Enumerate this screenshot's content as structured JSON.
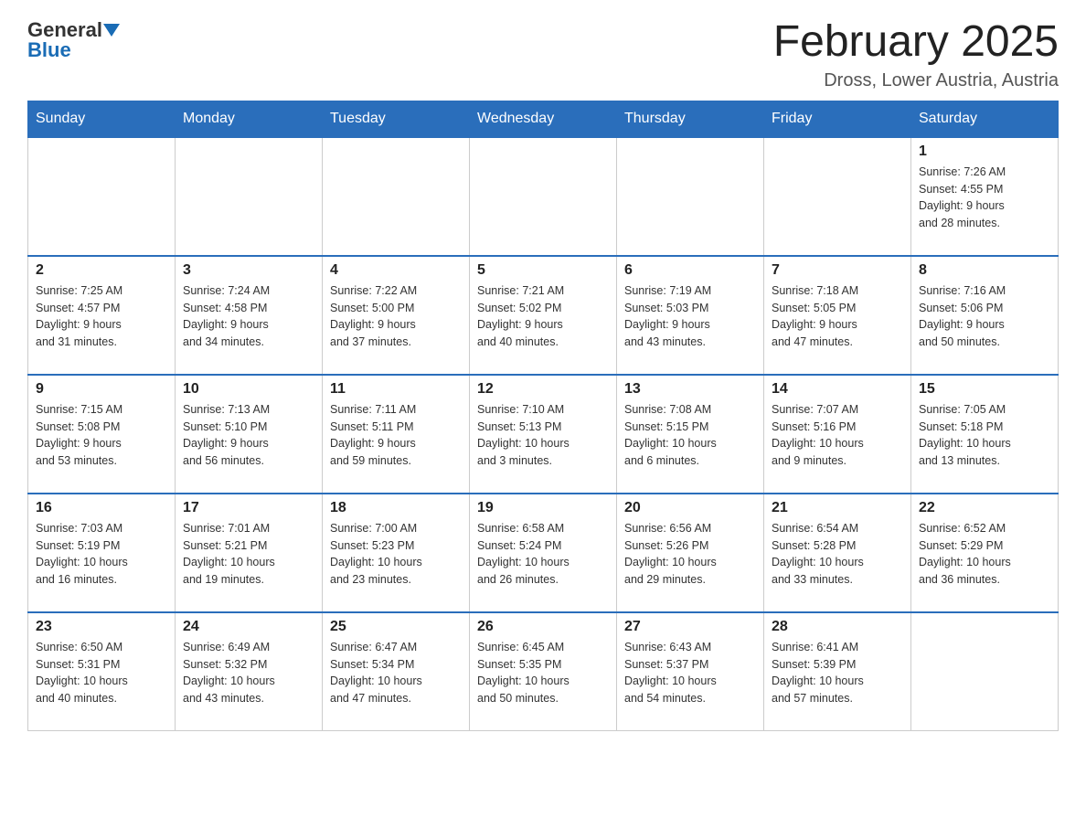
{
  "header": {
    "logo_general": "General",
    "logo_blue": "Blue",
    "month_title": "February 2025",
    "location": "Dross, Lower Austria, Austria"
  },
  "weekdays": [
    "Sunday",
    "Monday",
    "Tuesday",
    "Wednesday",
    "Thursday",
    "Friday",
    "Saturday"
  ],
  "weeks": [
    [
      {
        "day": "",
        "info": ""
      },
      {
        "day": "",
        "info": ""
      },
      {
        "day": "",
        "info": ""
      },
      {
        "day": "",
        "info": ""
      },
      {
        "day": "",
        "info": ""
      },
      {
        "day": "",
        "info": ""
      },
      {
        "day": "1",
        "info": "Sunrise: 7:26 AM\nSunset: 4:55 PM\nDaylight: 9 hours\nand 28 minutes."
      }
    ],
    [
      {
        "day": "2",
        "info": "Sunrise: 7:25 AM\nSunset: 4:57 PM\nDaylight: 9 hours\nand 31 minutes."
      },
      {
        "day": "3",
        "info": "Sunrise: 7:24 AM\nSunset: 4:58 PM\nDaylight: 9 hours\nand 34 minutes."
      },
      {
        "day": "4",
        "info": "Sunrise: 7:22 AM\nSunset: 5:00 PM\nDaylight: 9 hours\nand 37 minutes."
      },
      {
        "day": "5",
        "info": "Sunrise: 7:21 AM\nSunset: 5:02 PM\nDaylight: 9 hours\nand 40 minutes."
      },
      {
        "day": "6",
        "info": "Sunrise: 7:19 AM\nSunset: 5:03 PM\nDaylight: 9 hours\nand 43 minutes."
      },
      {
        "day": "7",
        "info": "Sunrise: 7:18 AM\nSunset: 5:05 PM\nDaylight: 9 hours\nand 47 minutes."
      },
      {
        "day": "8",
        "info": "Sunrise: 7:16 AM\nSunset: 5:06 PM\nDaylight: 9 hours\nand 50 minutes."
      }
    ],
    [
      {
        "day": "9",
        "info": "Sunrise: 7:15 AM\nSunset: 5:08 PM\nDaylight: 9 hours\nand 53 minutes."
      },
      {
        "day": "10",
        "info": "Sunrise: 7:13 AM\nSunset: 5:10 PM\nDaylight: 9 hours\nand 56 minutes."
      },
      {
        "day": "11",
        "info": "Sunrise: 7:11 AM\nSunset: 5:11 PM\nDaylight: 9 hours\nand 59 minutes."
      },
      {
        "day": "12",
        "info": "Sunrise: 7:10 AM\nSunset: 5:13 PM\nDaylight: 10 hours\nand 3 minutes."
      },
      {
        "day": "13",
        "info": "Sunrise: 7:08 AM\nSunset: 5:15 PM\nDaylight: 10 hours\nand 6 minutes."
      },
      {
        "day": "14",
        "info": "Sunrise: 7:07 AM\nSunset: 5:16 PM\nDaylight: 10 hours\nand 9 minutes."
      },
      {
        "day": "15",
        "info": "Sunrise: 7:05 AM\nSunset: 5:18 PM\nDaylight: 10 hours\nand 13 minutes."
      }
    ],
    [
      {
        "day": "16",
        "info": "Sunrise: 7:03 AM\nSunset: 5:19 PM\nDaylight: 10 hours\nand 16 minutes."
      },
      {
        "day": "17",
        "info": "Sunrise: 7:01 AM\nSunset: 5:21 PM\nDaylight: 10 hours\nand 19 minutes."
      },
      {
        "day": "18",
        "info": "Sunrise: 7:00 AM\nSunset: 5:23 PM\nDaylight: 10 hours\nand 23 minutes."
      },
      {
        "day": "19",
        "info": "Sunrise: 6:58 AM\nSunset: 5:24 PM\nDaylight: 10 hours\nand 26 minutes."
      },
      {
        "day": "20",
        "info": "Sunrise: 6:56 AM\nSunset: 5:26 PM\nDaylight: 10 hours\nand 29 minutes."
      },
      {
        "day": "21",
        "info": "Sunrise: 6:54 AM\nSunset: 5:28 PM\nDaylight: 10 hours\nand 33 minutes."
      },
      {
        "day": "22",
        "info": "Sunrise: 6:52 AM\nSunset: 5:29 PM\nDaylight: 10 hours\nand 36 minutes."
      }
    ],
    [
      {
        "day": "23",
        "info": "Sunrise: 6:50 AM\nSunset: 5:31 PM\nDaylight: 10 hours\nand 40 minutes."
      },
      {
        "day": "24",
        "info": "Sunrise: 6:49 AM\nSunset: 5:32 PM\nDaylight: 10 hours\nand 43 minutes."
      },
      {
        "day": "25",
        "info": "Sunrise: 6:47 AM\nSunset: 5:34 PM\nDaylight: 10 hours\nand 47 minutes."
      },
      {
        "day": "26",
        "info": "Sunrise: 6:45 AM\nSunset: 5:35 PM\nDaylight: 10 hours\nand 50 minutes."
      },
      {
        "day": "27",
        "info": "Sunrise: 6:43 AM\nSunset: 5:37 PM\nDaylight: 10 hours\nand 54 minutes."
      },
      {
        "day": "28",
        "info": "Sunrise: 6:41 AM\nSunset: 5:39 PM\nDaylight: 10 hours\nand 57 minutes."
      },
      {
        "day": "",
        "info": ""
      }
    ]
  ]
}
